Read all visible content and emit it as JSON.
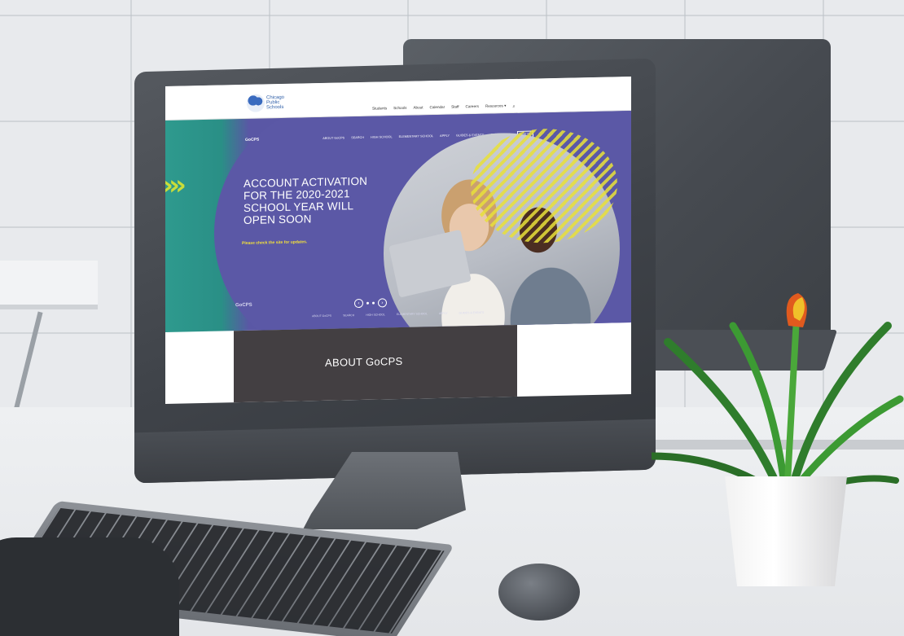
{
  "site": {
    "logo_text": "Chicago Public Schools",
    "main_nav": [
      "Students",
      "Schools",
      "About",
      "Calendar",
      "Staff",
      "Careers",
      "Resources ▾"
    ],
    "sub_brand": "GoCPS",
    "sub_nav": [
      "ABOUT GoCPS",
      "SEARCH",
      "HIGH SCHOOL",
      "ELEMENTARY SCHOOL",
      "APPLY",
      "GUIDES & EVENTS",
      "CONTACT US"
    ],
    "login_label": "LOG IN",
    "hero": {
      "title": "ACCOUNT ACTIVATION FOR THE 2020-2021 SCHOOL YEAR WILL OPEN SOON",
      "subtitle": "Please check the site for updates."
    },
    "footer_brand": "GoCPS",
    "bottom_links": [
      "ABOUT GoCPS",
      "SEARCH",
      "HIGH SCHOOL",
      "ELEMENTARY SCHOOL",
      "APPLY",
      "GUIDES & EVENTS"
    ],
    "about_title": "ABOUT GoCPS"
  },
  "icons": {
    "search": "search-icon",
    "prev": "chevron-left-icon",
    "next": "chevron-right-icon",
    "apple": "apple-logo-icon"
  },
  "colors": {
    "hero_purple": "#5b58a6",
    "teal": "#2e9a8e",
    "accent_yellow": "#f4e23a",
    "chevron_lime": "#c9dd3a",
    "about_band": "#433f42"
  }
}
